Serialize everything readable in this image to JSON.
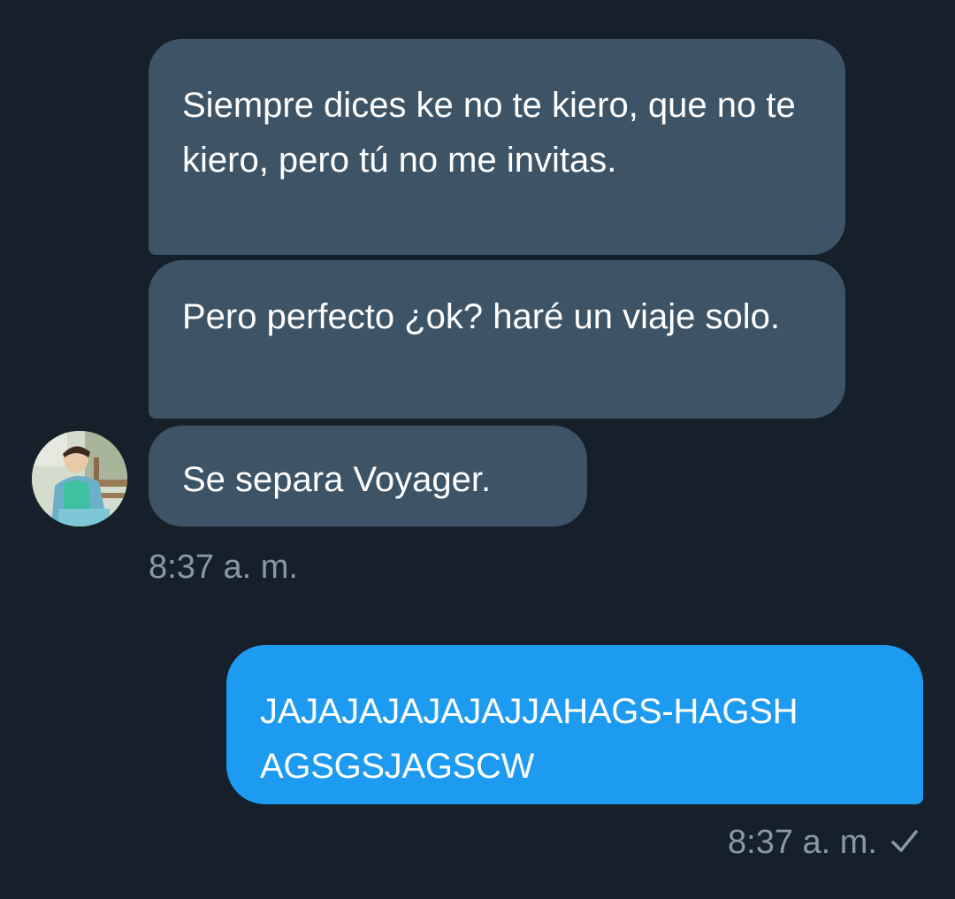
{
  "conversation": {
    "received": [
      {
        "text": "Siempre dices ke no te kiero, que no te kiero, pero tú no me invitas."
      },
      {
        "text": "Pero perfecto ¿ok? haré un viaje solo."
      },
      {
        "text": "Se separa Voyager."
      }
    ],
    "received_timestamp": "8:37 a. m.",
    "sender_avatar": "avatar-photo",
    "sent": [
      {
        "text": "JAJAJAJAJAJAJJAHAGS-HAGSHAGSGSJAGSCW"
      }
    ],
    "sent_timestamp": "8:37 a. m.",
    "sent_status_icon": "checkmark-icon"
  },
  "colors": {
    "background": "#15202b",
    "received_bubble": "#3d5466",
    "sent_bubble": "#1d9bf0",
    "timestamp": "#8899a6"
  }
}
